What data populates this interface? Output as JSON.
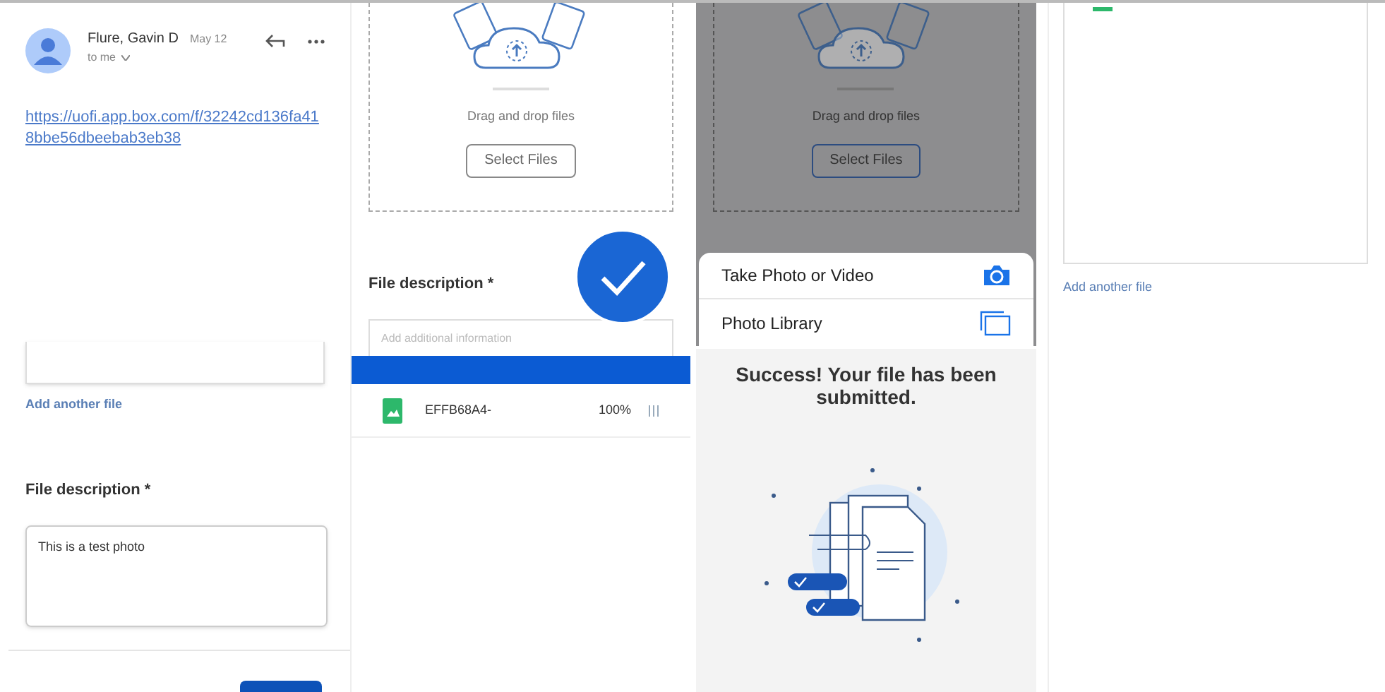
{
  "email": {
    "sender": "Flure, Gavin D",
    "date": "May 12",
    "recipient": "to me",
    "link": "https://uofi.app.box.com/f/32242cd136fa418bbe56dbeebab3eb38"
  },
  "form_lower": {
    "add_link": "Add another file",
    "description_label": "File description *",
    "description_value": "This is a test photo"
  },
  "upload_form": {
    "drop_text": "Drag and drop files",
    "select_button": "Select Files",
    "description_label": "File description *",
    "placeholder": "Add additional information",
    "complete": true,
    "files": [
      {
        "name": "EFFB68A4-",
        "progress": "100%",
        "color": "#2db86b"
      }
    ]
  },
  "picker": {
    "drop_text": "Drag and drop files",
    "select_button": "Select Files",
    "options": [
      {
        "label": "Take Photo or Video",
        "kind": "camera"
      },
      {
        "label": "Photo Library",
        "kind": "library"
      }
    ]
  },
  "success": {
    "message": "Success! Your file has been submitted."
  },
  "file_list": {
    "add_link": "Add another file"
  }
}
